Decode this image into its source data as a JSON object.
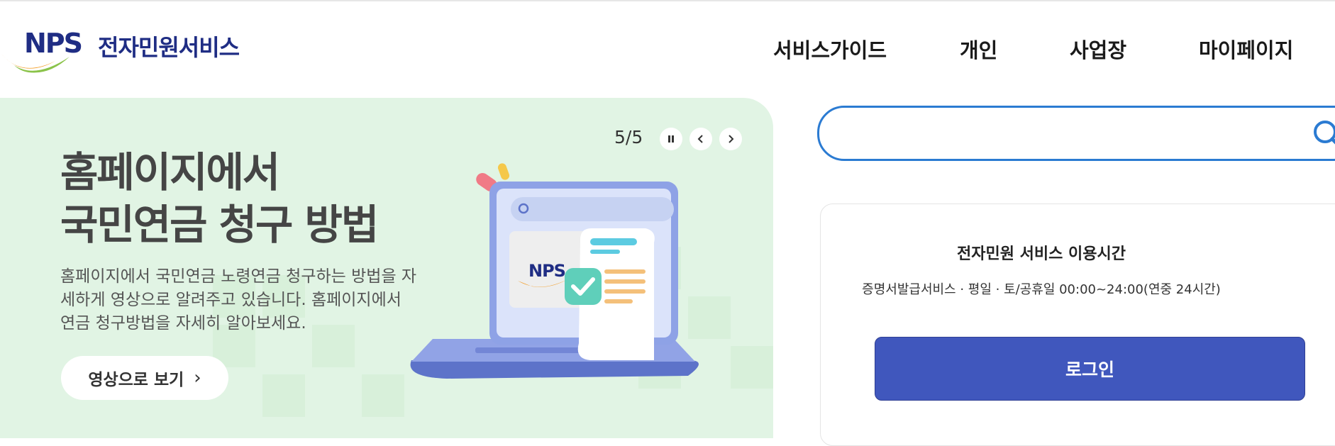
{
  "brand": {
    "logo_text": "NPS",
    "service_name": "전자민원서비스"
  },
  "nav": {
    "items": [
      {
        "label": "서비스가이드"
      },
      {
        "label": "개인"
      },
      {
        "label": "사업장"
      },
      {
        "label": "마이페이지"
      }
    ]
  },
  "banner": {
    "title": "홈페이지에서\n국민연금 청구 방법",
    "description": "홈페이지에서 국민연금 노령연금 청구하는 방법을 자세하게 영상으로 알려주고 있습니다. 홈페이지에서 연금 청구방법을 자세히 알아보세요.",
    "button_label": "영상으로 보기",
    "pager": "5/5",
    "illustration_logo": "NPS",
    "colors": {
      "background": "#e1f4e4",
      "button": "#ffffff"
    }
  },
  "search": {
    "placeholder": "",
    "value": "",
    "icon": "search-icon"
  },
  "service_hours": {
    "title": "전자민원 서비스 이용시간",
    "detail": "증명서발급서비스 · 평일 · 토/공휴일 00:00~24:00(연중 24시간)",
    "login_label": "로그인",
    "colors": {
      "login_button": "#4057bd"
    }
  }
}
